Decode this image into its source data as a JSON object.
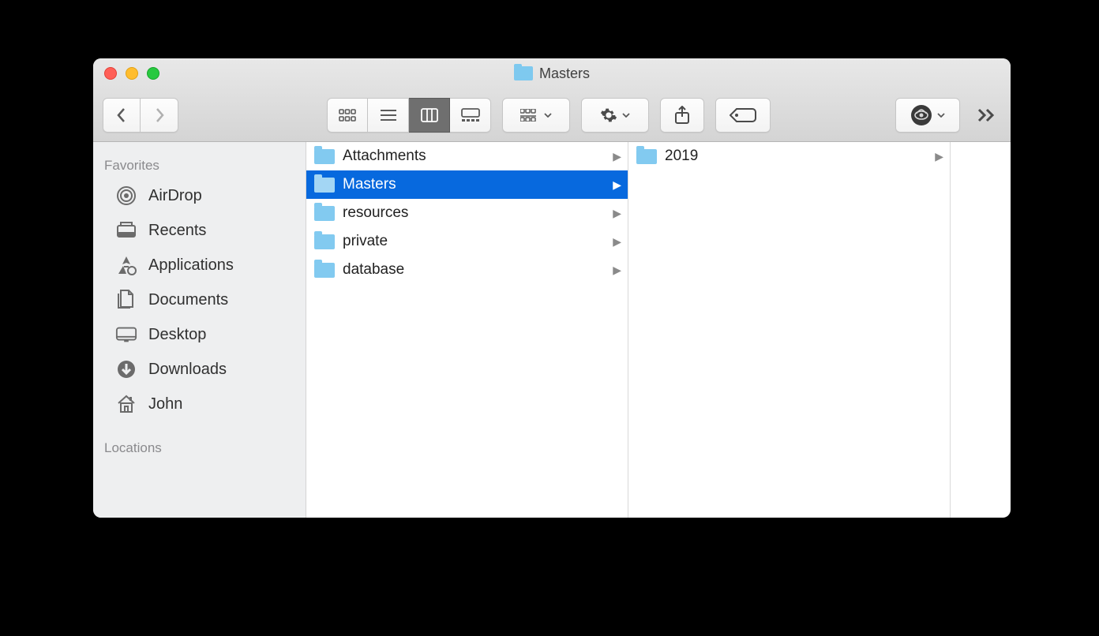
{
  "window": {
    "title": "Masters"
  },
  "sidebar": {
    "sections": [
      {
        "heading": "Favorites",
        "items": [
          {
            "label": "AirDrop",
            "icon": "airdrop-icon"
          },
          {
            "label": "Recents",
            "icon": "recents-icon"
          },
          {
            "label": "Applications",
            "icon": "applications-icon"
          },
          {
            "label": "Documents",
            "icon": "documents-icon"
          },
          {
            "label": "Desktop",
            "icon": "desktop-icon"
          },
          {
            "label": "Downloads",
            "icon": "downloads-icon"
          },
          {
            "label": "John",
            "icon": "home-icon"
          }
        ]
      },
      {
        "heading": "Locations",
        "items": []
      }
    ]
  },
  "columns": [
    {
      "items": [
        {
          "label": "Attachments",
          "has_children": true,
          "selected": false
        },
        {
          "label": "Masters",
          "has_children": true,
          "selected": true
        },
        {
          "label": "resources",
          "has_children": true,
          "selected": false
        },
        {
          "label": "private",
          "has_children": true,
          "selected": false
        },
        {
          "label": "database",
          "has_children": true,
          "selected": false
        }
      ]
    },
    {
      "items": [
        {
          "label": "2019",
          "has_children": true,
          "selected": false
        }
      ]
    }
  ],
  "toolbar": {
    "view_modes": [
      "icon",
      "list",
      "column",
      "gallery"
    ],
    "active_view": "column"
  }
}
